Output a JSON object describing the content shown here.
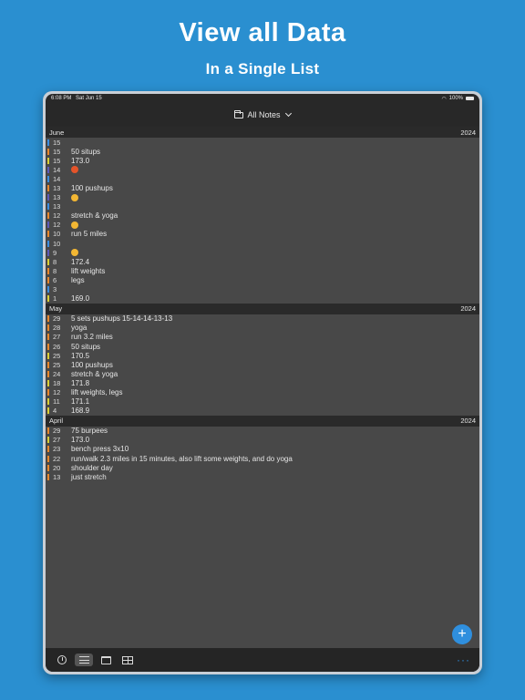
{
  "promo": {
    "title": "View all Data",
    "subtitle": "In a Single List"
  },
  "status_bar": {
    "time": "6:08 PM",
    "date": "Sat Jun 15",
    "battery": "100%"
  },
  "nav": {
    "title": "All Notes"
  },
  "colors": {
    "orange": "#e8872c",
    "yellow": "#d9cf36",
    "blue": "#3b8de0",
    "purple": "#5e5ab8",
    "green": "#6cc04a",
    "accent": "#2f8fde"
  },
  "sections": [
    {
      "month": "June",
      "year": "2024",
      "entries": [
        {
          "day": "15",
          "text": "",
          "color": "#3b8de0"
        },
        {
          "day": "15",
          "text": "50 situps",
          "color": "#e8872c"
        },
        {
          "day": "15",
          "text": "173.0",
          "color": "#d9cf36"
        },
        {
          "day": "14",
          "text": "",
          "color": "#5e5ab8",
          "emoji": "angry"
        },
        {
          "day": "14",
          "text": "",
          "color": "#3b8de0"
        },
        {
          "day": "13",
          "text": "100 pushups",
          "color": "#e8872c"
        },
        {
          "day": "13",
          "text": "",
          "color": "#5e5ab8",
          "emoji": "happy"
        },
        {
          "day": "13",
          "text": "",
          "color": "#3b8de0"
        },
        {
          "day": "12",
          "text": "stretch & yoga",
          "color": "#e8872c"
        },
        {
          "day": "12",
          "text": "",
          "color": "#5e5ab8",
          "emoji": "happy"
        },
        {
          "day": "10",
          "text": "run 5 miles",
          "color": "#e8872c"
        },
        {
          "day": "10",
          "text": "",
          "color": "#3b8de0"
        },
        {
          "day": "9",
          "text": "",
          "color": "#5e5ab8",
          "emoji": "happy"
        },
        {
          "day": "8",
          "text": "172.4",
          "color": "#d9cf36"
        },
        {
          "day": "8",
          "text": "lift weights",
          "color": "#e8872c"
        },
        {
          "day": "6",
          "text": "legs",
          "color": "#e8872c"
        },
        {
          "day": "3",
          "text": "",
          "color": "#3b8de0"
        },
        {
          "day": "1",
          "text": "169.0",
          "color": "#d9cf36"
        }
      ]
    },
    {
      "month": "May",
      "year": "2024",
      "entries": [
        {
          "day": "29",
          "text": "5 sets pushups 15-14-14-13-13",
          "color": "#e8872c"
        },
        {
          "day": "28",
          "text": "yoga",
          "color": "#e8872c"
        },
        {
          "day": "27",
          "text": "run 3.2 miles",
          "color": "#e8872c"
        },
        {
          "day": "26",
          "text": "50 situps",
          "color": "#e8872c"
        },
        {
          "day": "25",
          "text": "170.5",
          "color": "#d9cf36"
        },
        {
          "day": "25",
          "text": "100 pushups",
          "color": "#e8872c"
        },
        {
          "day": "24",
          "text": "stretch & yoga",
          "color": "#e8872c"
        },
        {
          "day": "18",
          "text": "171.8",
          "color": "#d9cf36"
        },
        {
          "day": "12",
          "text": "lift weights, legs",
          "color": "#e8872c"
        },
        {
          "day": "11",
          "text": "171.1",
          "color": "#d9cf36"
        },
        {
          "day": "4",
          "text": "168.9",
          "color": "#d9cf36"
        }
      ]
    },
    {
      "month": "April",
      "year": "2024",
      "entries": [
        {
          "day": "29",
          "text": "75 burpees",
          "color": "#e8872c"
        },
        {
          "day": "27",
          "text": "173.0",
          "color": "#d9cf36"
        },
        {
          "day": "23",
          "text": "bench press 3x10",
          "color": "#e8872c"
        },
        {
          "day": "22",
          "text": "run/walk 2.3 miles in 15 minutes, also lift some weights, and do yoga",
          "color": "#e8872c"
        },
        {
          "day": "20",
          "text": "shoulder day",
          "color": "#e8872c"
        },
        {
          "day": "13",
          "text": "just stretch",
          "color": "#e8872c"
        }
      ]
    }
  ],
  "fab": {
    "label": "+"
  },
  "tab_bar": {
    "tabs": [
      {
        "name": "timeline",
        "icon": "clock-icon",
        "active": false
      },
      {
        "name": "list",
        "icon": "list-icon",
        "active": true
      },
      {
        "name": "calendar",
        "icon": "calendar-icon",
        "active": false
      },
      {
        "name": "table",
        "icon": "table-icon",
        "active": false
      }
    ],
    "more_label": "···"
  }
}
